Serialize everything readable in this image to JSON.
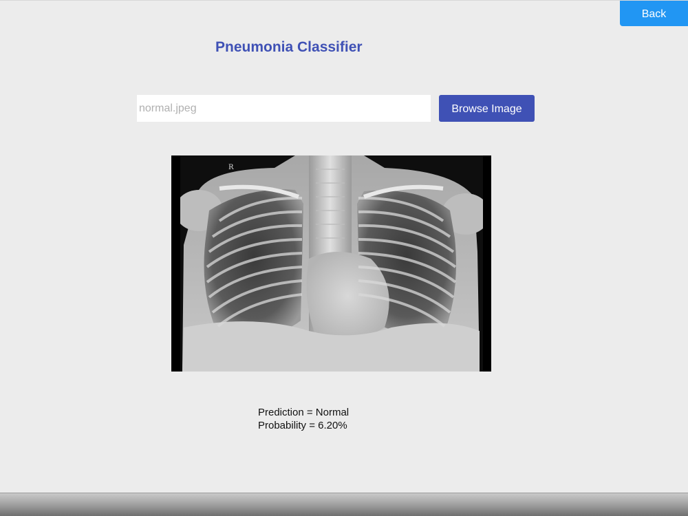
{
  "header": {
    "back_label": "Back"
  },
  "main": {
    "title": "Pneumonia Classifier",
    "file_input": {
      "value": "",
      "placeholder": "normal.jpeg"
    },
    "browse_label": "Browse Image",
    "image": {
      "marker": "R"
    },
    "result": {
      "prediction": "Prediction = Normal",
      "probability": "Probability = 6.20%"
    }
  },
  "colors": {
    "accent": "#3f51b5",
    "back_button": "#2196f3",
    "background": "#ececec"
  }
}
